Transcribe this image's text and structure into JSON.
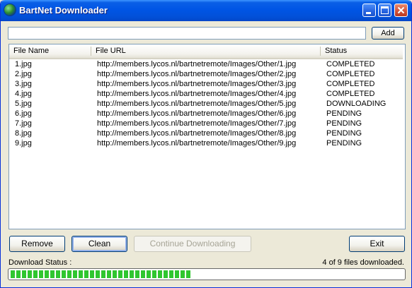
{
  "window": {
    "title": "BartNet Downloader"
  },
  "url_input": {
    "value": ""
  },
  "buttons": {
    "add": "Add",
    "remove": "Remove",
    "clean": "Clean",
    "continue": "Continue Downloading",
    "exit": "Exit"
  },
  "list": {
    "columns": [
      "File Name",
      "File URL",
      "Status"
    ],
    "rows": [
      {
        "name": "1.jpg",
        "url": "http://members.lycos.nl/bartnetremote/Images/Other/1.jpg",
        "status": "COMPLETED"
      },
      {
        "name": "2.jpg",
        "url": "http://members.lycos.nl/bartnetremote/Images/Other/2.jpg",
        "status": "COMPLETED"
      },
      {
        "name": "3.jpg",
        "url": "http://members.lycos.nl/bartnetremote/Images/Other/3.jpg",
        "status": "COMPLETED"
      },
      {
        "name": "4.jpg",
        "url": "http://members.lycos.nl/bartnetremote/Images/Other/4.jpg",
        "status": "COMPLETED"
      },
      {
        "name": "5.jpg",
        "url": "http://members.lycos.nl/bartnetremote/Images/Other/5.jpg",
        "status": "DOWNLOADING"
      },
      {
        "name": "6.jpg",
        "url": "http://members.lycos.nl/bartnetremote/Images/Other/6.jpg",
        "status": "PENDING"
      },
      {
        "name": "7.jpg",
        "url": "http://members.lycos.nl/bartnetremote/Images/Other/7.jpg",
        "status": "PENDING"
      },
      {
        "name": "8.jpg",
        "url": "http://members.lycos.nl/bartnetremote/Images/Other/8.jpg",
        "status": "PENDING"
      },
      {
        "name": "9.jpg",
        "url": "http://members.lycos.nl/bartnetremote/Images/Other/9.jpg",
        "status": "PENDING"
      }
    ]
  },
  "status": {
    "label": "Download Status :",
    "progress_text": "4 of 9 files downloaded.",
    "progress_fraction": 0.46
  },
  "colors": {
    "progress_fill": "#2fc62f",
    "titlebar": "#0055e5"
  },
  "icons": {
    "app": "globe-icon",
    "minimize": "minimize-icon",
    "maximize": "maximize-icon",
    "close": "close-icon"
  }
}
